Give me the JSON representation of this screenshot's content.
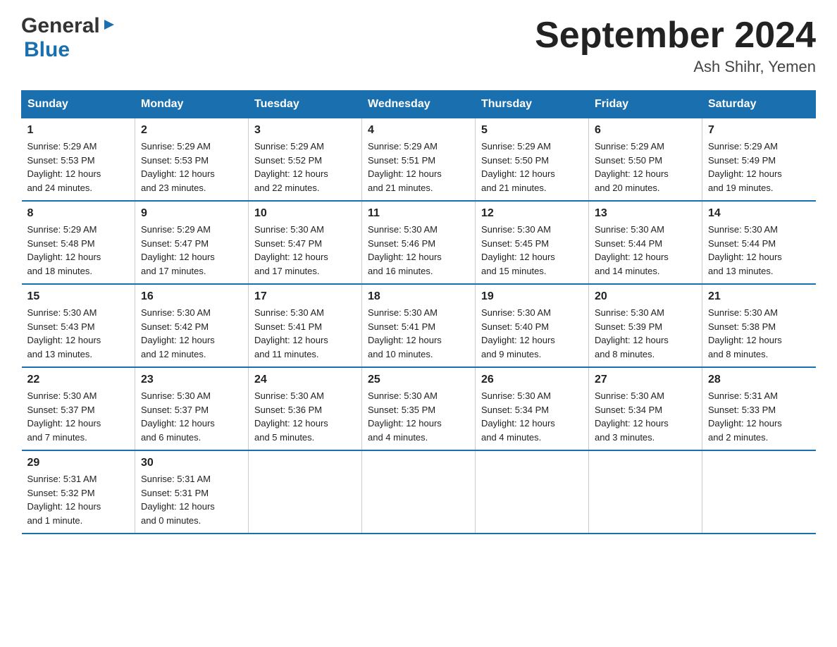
{
  "header": {
    "logo_general": "General",
    "logo_blue": "Blue",
    "month_title": "September 2024",
    "location": "Ash Shihr, Yemen"
  },
  "days_of_week": [
    "Sunday",
    "Monday",
    "Tuesday",
    "Wednesday",
    "Thursday",
    "Friday",
    "Saturday"
  ],
  "weeks": [
    [
      {
        "num": "1",
        "sunrise": "5:29 AM",
        "sunset": "5:53 PM",
        "daylight": "12 hours and 24 minutes."
      },
      {
        "num": "2",
        "sunrise": "5:29 AM",
        "sunset": "5:53 PM",
        "daylight": "12 hours and 23 minutes."
      },
      {
        "num": "3",
        "sunrise": "5:29 AM",
        "sunset": "5:52 PM",
        "daylight": "12 hours and 22 minutes."
      },
      {
        "num": "4",
        "sunrise": "5:29 AM",
        "sunset": "5:51 PM",
        "daylight": "12 hours and 21 minutes."
      },
      {
        "num": "5",
        "sunrise": "5:29 AM",
        "sunset": "5:50 PM",
        "daylight": "12 hours and 21 minutes."
      },
      {
        "num": "6",
        "sunrise": "5:29 AM",
        "sunset": "5:50 PM",
        "daylight": "12 hours and 20 minutes."
      },
      {
        "num": "7",
        "sunrise": "5:29 AM",
        "sunset": "5:49 PM",
        "daylight": "12 hours and 19 minutes."
      }
    ],
    [
      {
        "num": "8",
        "sunrise": "5:29 AM",
        "sunset": "5:48 PM",
        "daylight": "12 hours and 18 minutes."
      },
      {
        "num": "9",
        "sunrise": "5:29 AM",
        "sunset": "5:47 PM",
        "daylight": "12 hours and 17 minutes."
      },
      {
        "num": "10",
        "sunrise": "5:30 AM",
        "sunset": "5:47 PM",
        "daylight": "12 hours and 17 minutes."
      },
      {
        "num": "11",
        "sunrise": "5:30 AM",
        "sunset": "5:46 PM",
        "daylight": "12 hours and 16 minutes."
      },
      {
        "num": "12",
        "sunrise": "5:30 AM",
        "sunset": "5:45 PM",
        "daylight": "12 hours and 15 minutes."
      },
      {
        "num": "13",
        "sunrise": "5:30 AM",
        "sunset": "5:44 PM",
        "daylight": "12 hours and 14 minutes."
      },
      {
        "num": "14",
        "sunrise": "5:30 AM",
        "sunset": "5:44 PM",
        "daylight": "12 hours and 13 minutes."
      }
    ],
    [
      {
        "num": "15",
        "sunrise": "5:30 AM",
        "sunset": "5:43 PM",
        "daylight": "12 hours and 13 minutes."
      },
      {
        "num": "16",
        "sunrise": "5:30 AM",
        "sunset": "5:42 PM",
        "daylight": "12 hours and 12 minutes."
      },
      {
        "num": "17",
        "sunrise": "5:30 AM",
        "sunset": "5:41 PM",
        "daylight": "12 hours and 11 minutes."
      },
      {
        "num": "18",
        "sunrise": "5:30 AM",
        "sunset": "5:41 PM",
        "daylight": "12 hours and 10 minutes."
      },
      {
        "num": "19",
        "sunrise": "5:30 AM",
        "sunset": "5:40 PM",
        "daylight": "12 hours and 9 minutes."
      },
      {
        "num": "20",
        "sunrise": "5:30 AM",
        "sunset": "5:39 PM",
        "daylight": "12 hours and 8 minutes."
      },
      {
        "num": "21",
        "sunrise": "5:30 AM",
        "sunset": "5:38 PM",
        "daylight": "12 hours and 8 minutes."
      }
    ],
    [
      {
        "num": "22",
        "sunrise": "5:30 AM",
        "sunset": "5:37 PM",
        "daylight": "12 hours and 7 minutes."
      },
      {
        "num": "23",
        "sunrise": "5:30 AM",
        "sunset": "5:37 PM",
        "daylight": "12 hours and 6 minutes."
      },
      {
        "num": "24",
        "sunrise": "5:30 AM",
        "sunset": "5:36 PM",
        "daylight": "12 hours and 5 minutes."
      },
      {
        "num": "25",
        "sunrise": "5:30 AM",
        "sunset": "5:35 PM",
        "daylight": "12 hours and 4 minutes."
      },
      {
        "num": "26",
        "sunrise": "5:30 AM",
        "sunset": "5:34 PM",
        "daylight": "12 hours and 4 minutes."
      },
      {
        "num": "27",
        "sunrise": "5:30 AM",
        "sunset": "5:34 PM",
        "daylight": "12 hours and 3 minutes."
      },
      {
        "num": "28",
        "sunrise": "5:31 AM",
        "sunset": "5:33 PM",
        "daylight": "12 hours and 2 minutes."
      }
    ],
    [
      {
        "num": "29",
        "sunrise": "5:31 AM",
        "sunset": "5:32 PM",
        "daylight": "12 hours and 1 minute."
      },
      {
        "num": "30",
        "sunrise": "5:31 AM",
        "sunset": "5:31 PM",
        "daylight": "12 hours and 0 minutes."
      },
      null,
      null,
      null,
      null,
      null
    ]
  ],
  "labels": {
    "sunrise": "Sunrise:",
    "sunset": "Sunset:",
    "daylight": "Daylight:"
  }
}
